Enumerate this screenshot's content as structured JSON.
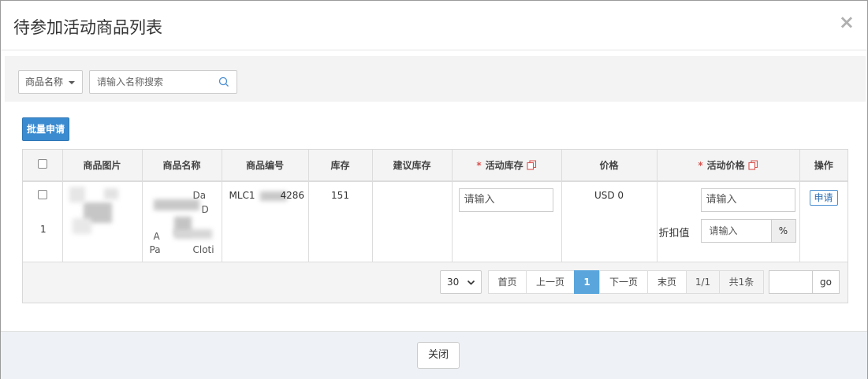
{
  "modal": {
    "title": "待参加活动商品列表",
    "close_icon": "×"
  },
  "filter": {
    "field_select": "商品名称",
    "search_placeholder": "请输入名称搜索"
  },
  "toolbar": {
    "batch_apply": "批量申请"
  },
  "table": {
    "headers": {
      "image": "商品图片",
      "name": "商品名称",
      "code": "商品编号",
      "stock": "库存",
      "suggested_stock": "建议库存",
      "activity_stock": "活动库存",
      "price": "价格",
      "activity_price": "活动价格",
      "action": "操作"
    },
    "required_mark": "*",
    "rows": [
      {
        "index": "1",
        "name_line1": "Da",
        "name_line2": "D",
        "name_line3": "A",
        "name_line4": "Pa",
        "name_line4b": "Cloti",
        "code_prefix": "MLC1",
        "code_suffix": "4286",
        "stock": "151",
        "activity_stock_placeholder": "请输入",
        "price": "USD 0",
        "activity_price_placeholder": "请输入",
        "discount_label": "折扣值",
        "discount_placeholder": "请输入",
        "percent": "%",
        "apply": "申请"
      }
    ]
  },
  "pagination": {
    "page_size": "30",
    "first": "首页",
    "prev": "上一页",
    "current": "1",
    "next": "下一页",
    "last": "末页",
    "page_info": "1/1",
    "total": "共1条",
    "go": "go"
  },
  "footer": {
    "close": "关闭"
  },
  "colors": {
    "primary": "#3b8bd0",
    "active_page": "#5aa6dc",
    "required": "#d9534f"
  }
}
